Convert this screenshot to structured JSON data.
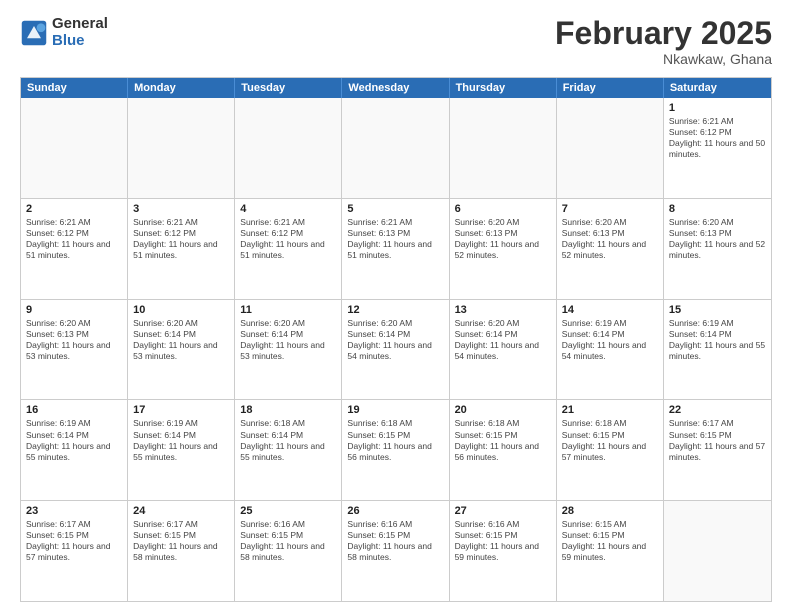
{
  "header": {
    "logo_general": "General",
    "logo_blue": "Blue",
    "title": "February 2025",
    "location": "Nkawkaw, Ghana"
  },
  "days_of_week": [
    "Sunday",
    "Monday",
    "Tuesday",
    "Wednesday",
    "Thursday",
    "Friday",
    "Saturday"
  ],
  "weeks": [
    [
      {
        "day": "",
        "empty": true
      },
      {
        "day": "",
        "empty": true
      },
      {
        "day": "",
        "empty": true
      },
      {
        "day": "",
        "empty": true
      },
      {
        "day": "",
        "empty": true
      },
      {
        "day": "",
        "empty": true
      },
      {
        "day": "1",
        "sunrise": "Sunrise: 6:21 AM",
        "sunset": "Sunset: 6:12 PM",
        "daylight": "Daylight: 11 hours and 50 minutes."
      }
    ],
    [
      {
        "day": "2",
        "sunrise": "Sunrise: 6:21 AM",
        "sunset": "Sunset: 6:12 PM",
        "daylight": "Daylight: 11 hours and 51 minutes."
      },
      {
        "day": "3",
        "sunrise": "Sunrise: 6:21 AM",
        "sunset": "Sunset: 6:12 PM",
        "daylight": "Daylight: 11 hours and 51 minutes."
      },
      {
        "day": "4",
        "sunrise": "Sunrise: 6:21 AM",
        "sunset": "Sunset: 6:12 PM",
        "daylight": "Daylight: 11 hours and 51 minutes."
      },
      {
        "day": "5",
        "sunrise": "Sunrise: 6:21 AM",
        "sunset": "Sunset: 6:13 PM",
        "daylight": "Daylight: 11 hours and 51 minutes."
      },
      {
        "day": "6",
        "sunrise": "Sunrise: 6:20 AM",
        "sunset": "Sunset: 6:13 PM",
        "daylight": "Daylight: 11 hours and 52 minutes."
      },
      {
        "day": "7",
        "sunrise": "Sunrise: 6:20 AM",
        "sunset": "Sunset: 6:13 PM",
        "daylight": "Daylight: 11 hours and 52 minutes."
      },
      {
        "day": "8",
        "sunrise": "Sunrise: 6:20 AM",
        "sunset": "Sunset: 6:13 PM",
        "daylight": "Daylight: 11 hours and 52 minutes."
      }
    ],
    [
      {
        "day": "9",
        "sunrise": "Sunrise: 6:20 AM",
        "sunset": "Sunset: 6:13 PM",
        "daylight": "Daylight: 11 hours and 53 minutes."
      },
      {
        "day": "10",
        "sunrise": "Sunrise: 6:20 AM",
        "sunset": "Sunset: 6:14 PM",
        "daylight": "Daylight: 11 hours and 53 minutes."
      },
      {
        "day": "11",
        "sunrise": "Sunrise: 6:20 AM",
        "sunset": "Sunset: 6:14 PM",
        "daylight": "Daylight: 11 hours and 53 minutes."
      },
      {
        "day": "12",
        "sunrise": "Sunrise: 6:20 AM",
        "sunset": "Sunset: 6:14 PM",
        "daylight": "Daylight: 11 hours and 54 minutes."
      },
      {
        "day": "13",
        "sunrise": "Sunrise: 6:20 AM",
        "sunset": "Sunset: 6:14 PM",
        "daylight": "Daylight: 11 hours and 54 minutes."
      },
      {
        "day": "14",
        "sunrise": "Sunrise: 6:19 AM",
        "sunset": "Sunset: 6:14 PM",
        "daylight": "Daylight: 11 hours and 54 minutes."
      },
      {
        "day": "15",
        "sunrise": "Sunrise: 6:19 AM",
        "sunset": "Sunset: 6:14 PM",
        "daylight": "Daylight: 11 hours and 55 minutes."
      }
    ],
    [
      {
        "day": "16",
        "sunrise": "Sunrise: 6:19 AM",
        "sunset": "Sunset: 6:14 PM",
        "daylight": "Daylight: 11 hours and 55 minutes."
      },
      {
        "day": "17",
        "sunrise": "Sunrise: 6:19 AM",
        "sunset": "Sunset: 6:14 PM",
        "daylight": "Daylight: 11 hours and 55 minutes."
      },
      {
        "day": "18",
        "sunrise": "Sunrise: 6:18 AM",
        "sunset": "Sunset: 6:14 PM",
        "daylight": "Daylight: 11 hours and 55 minutes."
      },
      {
        "day": "19",
        "sunrise": "Sunrise: 6:18 AM",
        "sunset": "Sunset: 6:15 PM",
        "daylight": "Daylight: 11 hours and 56 minutes."
      },
      {
        "day": "20",
        "sunrise": "Sunrise: 6:18 AM",
        "sunset": "Sunset: 6:15 PM",
        "daylight": "Daylight: 11 hours and 56 minutes."
      },
      {
        "day": "21",
        "sunrise": "Sunrise: 6:18 AM",
        "sunset": "Sunset: 6:15 PM",
        "daylight": "Daylight: 11 hours and 57 minutes."
      },
      {
        "day": "22",
        "sunrise": "Sunrise: 6:17 AM",
        "sunset": "Sunset: 6:15 PM",
        "daylight": "Daylight: 11 hours and 57 minutes."
      }
    ],
    [
      {
        "day": "23",
        "sunrise": "Sunrise: 6:17 AM",
        "sunset": "Sunset: 6:15 PM",
        "daylight": "Daylight: 11 hours and 57 minutes."
      },
      {
        "day": "24",
        "sunrise": "Sunrise: 6:17 AM",
        "sunset": "Sunset: 6:15 PM",
        "daylight": "Daylight: 11 hours and 58 minutes."
      },
      {
        "day": "25",
        "sunrise": "Sunrise: 6:16 AM",
        "sunset": "Sunset: 6:15 PM",
        "daylight": "Daylight: 11 hours and 58 minutes."
      },
      {
        "day": "26",
        "sunrise": "Sunrise: 6:16 AM",
        "sunset": "Sunset: 6:15 PM",
        "daylight": "Daylight: 11 hours and 58 minutes."
      },
      {
        "day": "27",
        "sunrise": "Sunrise: 6:16 AM",
        "sunset": "Sunset: 6:15 PM",
        "daylight": "Daylight: 11 hours and 59 minutes."
      },
      {
        "day": "28",
        "sunrise": "Sunrise: 6:15 AM",
        "sunset": "Sunset: 6:15 PM",
        "daylight": "Daylight: 11 hours and 59 minutes."
      },
      {
        "day": "",
        "empty": true
      }
    ]
  ]
}
